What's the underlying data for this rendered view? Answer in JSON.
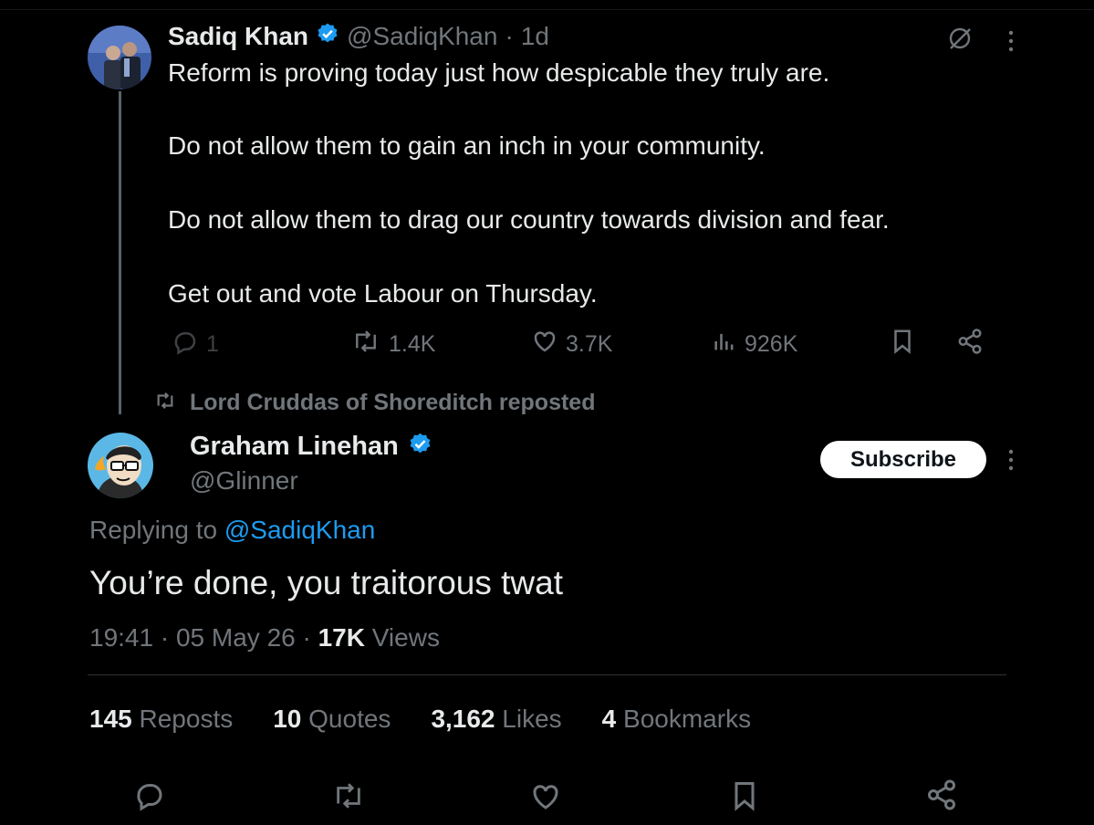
{
  "first_tweet": {
    "name": "Sadiq Khan",
    "handle": "@SadiqKhan",
    "time": "1d",
    "separator": "·",
    "paragraphs": [
      "Reform is proving today just how despicable they truly are.",
      "Do not allow them to gain an inch in your community.",
      "Do not allow them to drag our country towards division and fear.",
      "Get out and vote Labour on Thursday."
    ],
    "actions": {
      "replies": "1",
      "reposts": "1.4K",
      "likes": "3.7K",
      "views": "926K"
    }
  },
  "repost_notice": "Lord Cruddas of Shoreditch reposted",
  "main_tweet": {
    "name": "Graham Linehan",
    "handle": "@Glinner",
    "subscribe_label": "Subscribe",
    "replying_prefix": "Replying to",
    "replying_to": "@SadiqKhan",
    "text": "You’re done, you traitorous twat",
    "time": "19:41",
    "date": "05 May 26",
    "views_count": "17K",
    "views_label": "Views",
    "separator": "·"
  },
  "stats": [
    {
      "num": "145",
      "label": "Reposts"
    },
    {
      "num": "10",
      "label": "Quotes"
    },
    {
      "num": "3,162",
      "label": "Likes"
    },
    {
      "num": "4",
      "label": "Bookmarks"
    }
  ],
  "colors": {
    "background": "#000000",
    "text": "#e7e9ea",
    "muted": "#71767b",
    "link": "#1d9bf0",
    "verified": "#1d9bf0",
    "divider": "#2f3336"
  },
  "icons": [
    "verified-badge-icon",
    "grok-icon",
    "more-icon",
    "reply-icon",
    "repost-icon",
    "like-icon",
    "views-icon",
    "bookmark-icon",
    "share-icon"
  ]
}
